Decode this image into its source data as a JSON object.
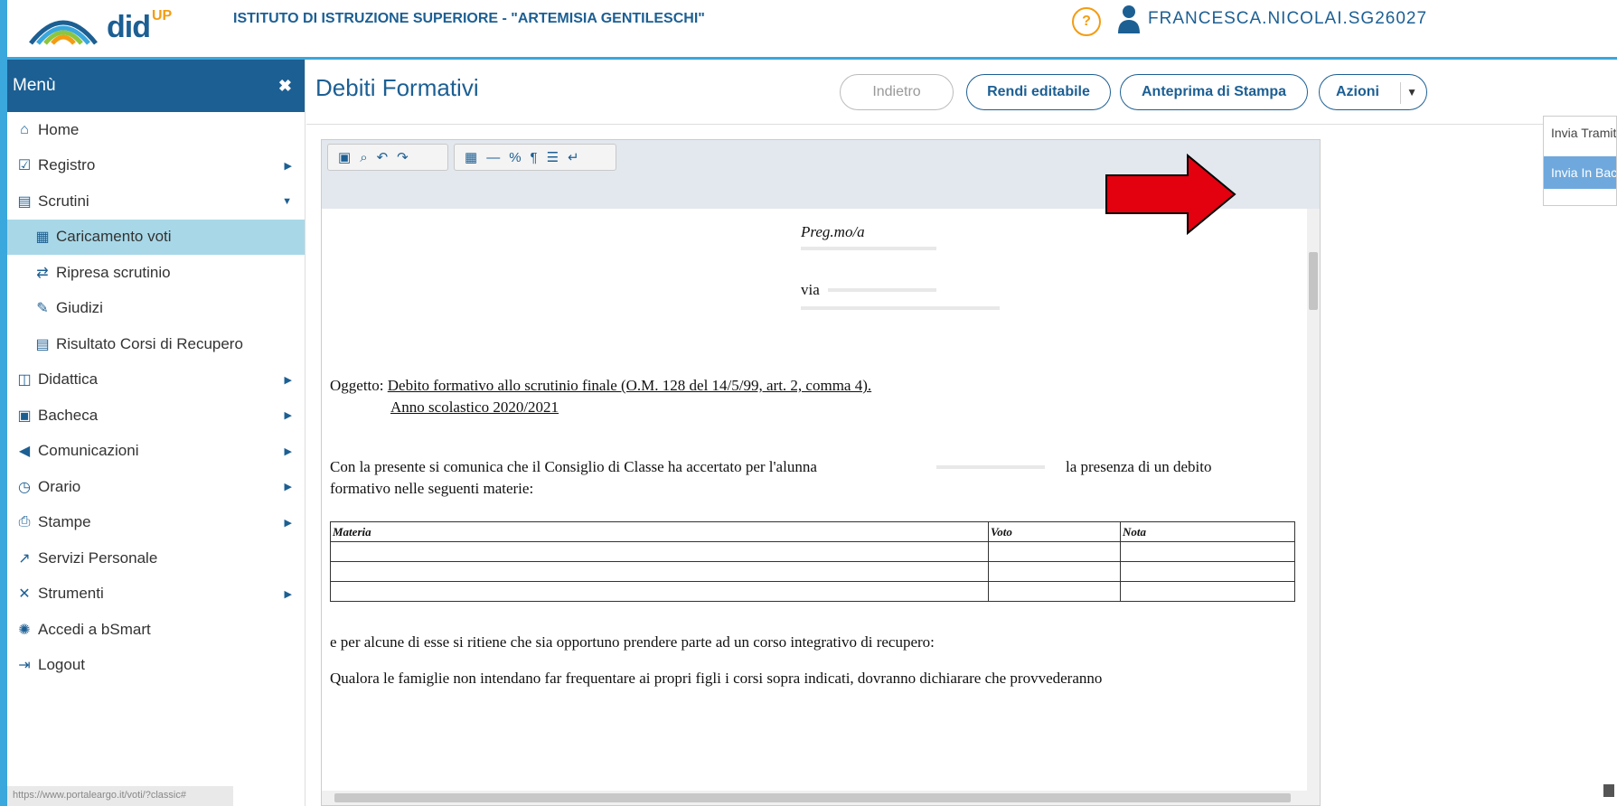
{
  "header": {
    "logo_word": "did",
    "logo_up": "UP",
    "school": "ISTITUTO DI ISTRUZIONE SUPERIORE - \"ARTEMISIA GENTILESCHI\"",
    "help": "?",
    "user": "FRANCESCA.NICOLAI.SG26027"
  },
  "sidebar": {
    "title": "Menù",
    "close": "✖",
    "items": [
      {
        "label": "Home",
        "icon": "home-icon"
      },
      {
        "label": "Registro",
        "icon": "calendar-check-icon"
      },
      {
        "label": "Scrutini",
        "icon": "document-icon"
      },
      {
        "label": "Caricamento voti",
        "icon": "grid-icon"
      },
      {
        "label": "Ripresa scrutinio",
        "icon": "refresh-icon"
      },
      {
        "label": "Giudizi",
        "icon": "edit-icon"
      },
      {
        "label": "Risultato Corsi di Recupero",
        "icon": "document-icon"
      },
      {
        "label": "Didattica",
        "icon": "book-icon"
      },
      {
        "label": "Bacheca",
        "icon": "board-icon"
      },
      {
        "label": "Comunicazioni",
        "icon": "megaphone-icon"
      },
      {
        "label": "Orario",
        "icon": "clock-icon"
      },
      {
        "label": "Stampe",
        "icon": "printer-icon"
      },
      {
        "label": "Servizi Personale",
        "icon": "share-icon"
      },
      {
        "label": "Strumenti",
        "icon": "tools-icon"
      },
      {
        "label": "Accedi a bSmart",
        "icon": "bsmart-icon"
      },
      {
        "label": "Logout",
        "icon": "logout-icon"
      }
    ],
    "status_url": "https://www.portaleargo.it/voti/?classic#"
  },
  "main": {
    "title": "Debiti Formativi",
    "buttons": {
      "back": "Indietro",
      "editable": "Rendi editabile",
      "preview": "Anteprima di Stampa",
      "actions": "Azioni"
    },
    "dropdown": [
      "Invia Tramite Email",
      "Invia In Bacheca"
    ]
  },
  "document": {
    "greeting": "Preg.mo/a",
    "address_via": "via",
    "oggetto_label": "Oggetto:",
    "oggetto_text": "Debito formativo allo scrutinio finale (O.M. 128 del 14/5/99, art. 2, comma 4).",
    "anno": "Anno scolastico 2020/2021",
    "body_start": "Con la  presente si comunica che il Consiglio di Classe ha accertato per l'alunna",
    "body_end": "la presenza di un debito",
    "body_line2": "formativo nelle seguenti materie:",
    "table_headers": [
      "Materia",
      "Voto",
      "Nota"
    ],
    "para2": "e per alcune di esse si ritiene che sia opportuno prendere parte ad un corso integrativo di recupero:",
    "para3": "Qualora le famiglie non intendano far frequentare ai propri figli i corsi sopra indicati, dovranno dichiarare che provvederanno"
  },
  "colors": {
    "brand": "#1c5f93",
    "accent": "#3aa7dd",
    "active_menu": "#a8d8e8",
    "dropdown_active": "#6fa8dc",
    "annotation_arrow": "#e3000f"
  }
}
